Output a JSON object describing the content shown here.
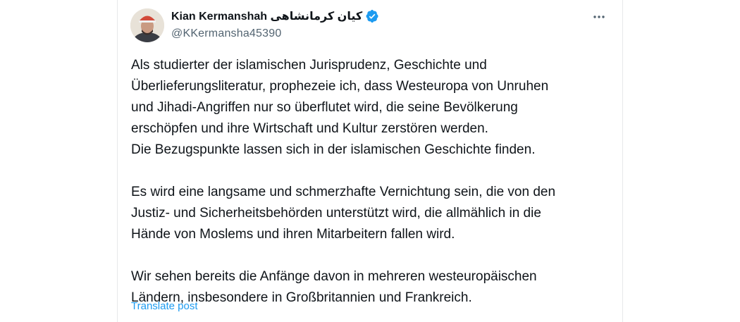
{
  "author": {
    "display_name": "Kian Kermanshah کیان کرمانشاهی",
    "handle": "@KKermansha45390",
    "verified": true,
    "avatar_icon": "profile-photo"
  },
  "actions": {
    "more_icon": "more-horizontal-icon"
  },
  "tweet": {
    "paragraphs": [
      "Als studierter der islamischen Jurisprudenz, Geschichte und\nÜberlieferungsliteratur, prophezeie ich, dass Westeuropa von Unruhen\nund Jihadi-Angriffen nur so überflutet wird, die seine Bevölkerung\nerschöpfen und ihre Wirtschaft und Kultur zerstören werden.\nDie Bezugspunkte lassen sich in der islamischen Geschichte finden.",
      "Es wird eine langsame und schmerzhafte Vernichtung sein, die von den\nJustiz- und Sicherheitsbehörden unterstützt wird, die allmählich in die\nHände von Moslems und ihren Mitarbeitern fallen wird.",
      "Wir sehen bereits die Anfänge davon in mehreren westeuropäischen\nLändern, insbesondere in Großbritannien und Frankreich."
    ],
    "translate_label": "Translate post"
  },
  "colors": {
    "text": "#0f1419",
    "secondary_text": "#536471",
    "accent": "#1d9bf0",
    "border": "#e7e9ea"
  }
}
